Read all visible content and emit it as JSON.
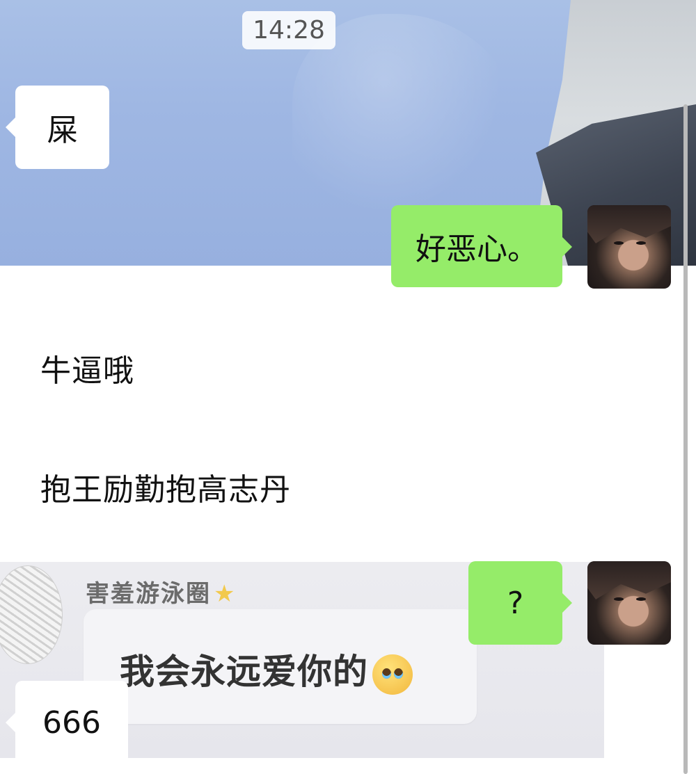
{
  "header": {
    "timestamp": "14:28"
  },
  "messages": [
    {
      "side": "left",
      "text": "屎"
    },
    {
      "side": "right",
      "text": "好恶心。"
    },
    {
      "side": "left",
      "text": "牛逼哦"
    },
    {
      "side": "left",
      "text": "抱王励勤抱高志丹"
    },
    {
      "side": "right",
      "text": "?"
    },
    {
      "side": "left",
      "text": "666"
    }
  ],
  "shared_image": {
    "name": "害羞游泳圈",
    "text": "我会永远爱你的",
    "emoji_icon": "pleading-face-icon",
    "badge_icon": "star-icon"
  },
  "colors": {
    "right_bubble": "#95ec69",
    "left_bubble": "#ffffff",
    "background": "#ffffff"
  }
}
